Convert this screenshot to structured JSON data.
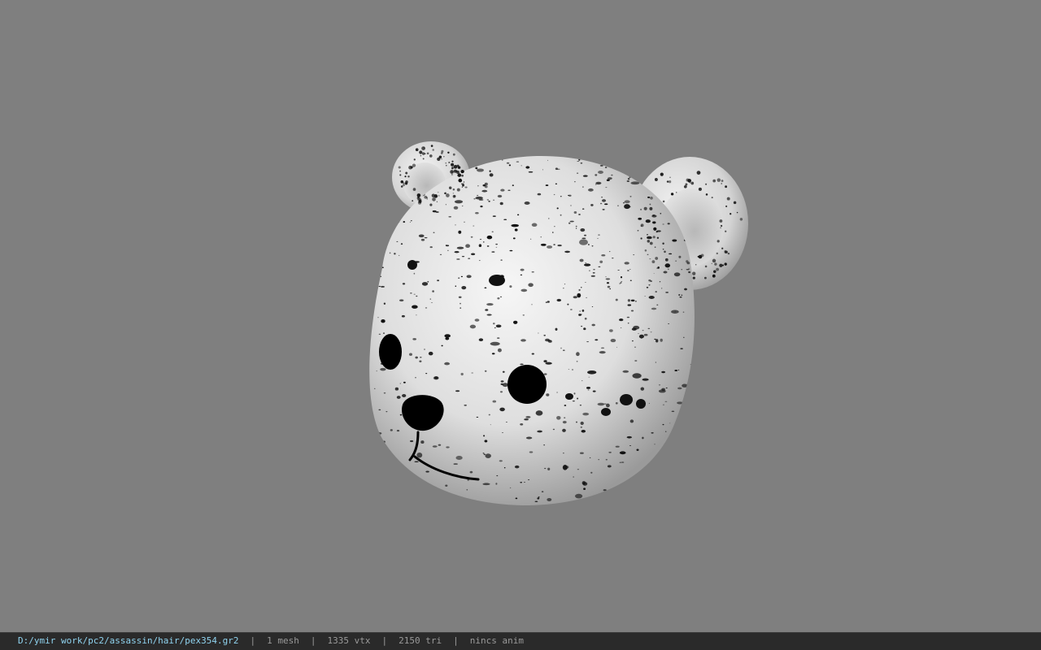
{
  "status_bar": {
    "file_path": "D:/ymir work/pc2/assassin/hair/pex354.gr2",
    "separator": "|",
    "mesh_count": "1 mesh",
    "vertex_count": "1335 vtx",
    "triangle_count": "2150 tri",
    "animation_status": "nincs anim"
  },
  "colors": {
    "viewport_background": "#7f7f7f",
    "status_bar_background": "#2a2a2a",
    "path_text": "#8fd3ef",
    "info_text": "#9a9a9a",
    "model_base": "#e2e2e2",
    "model_spots": "#111111"
  },
  "model": {
    "description_icon": "bear-head-model"
  }
}
